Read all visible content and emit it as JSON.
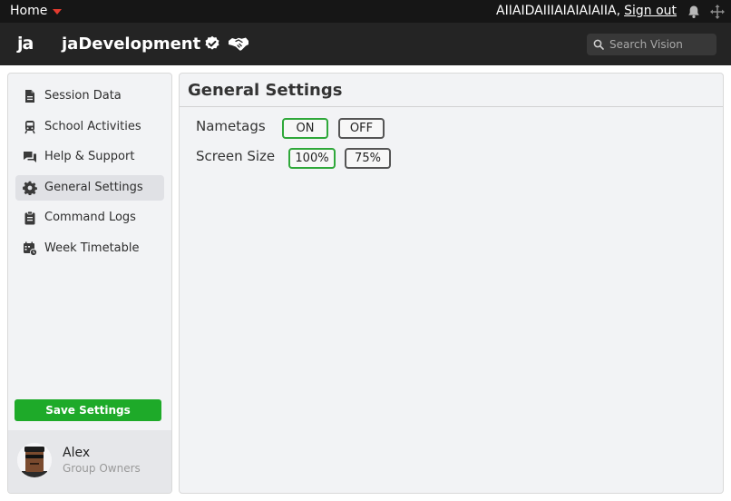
{
  "topbar": {
    "home_label": "Home",
    "username": "AIIAIDAIIIAIAIAIAIIA,",
    "signout_label": "Sign out"
  },
  "header": {
    "logo_text": "ja",
    "brand_name": "jaDevelopment",
    "search_placeholder": "Search Vision"
  },
  "sidebar": {
    "items": [
      {
        "label": "Session Data",
        "icon": "document-icon"
      },
      {
        "label": "School Activities",
        "icon": "train-icon"
      },
      {
        "label": "Help & Support",
        "icon": "chat-icon"
      },
      {
        "label": "General Settings",
        "icon": "gear-icon",
        "active": true
      },
      {
        "label": "Command Logs",
        "icon": "clipboard-icon"
      },
      {
        "label": "Week Timetable",
        "icon": "calendar-clock-icon"
      }
    ],
    "save_label": "Save Settings",
    "profile": {
      "name": "Alex",
      "role": "Group Owners"
    }
  },
  "main": {
    "title": "General Settings",
    "settings": [
      {
        "label": "Nametags",
        "options": [
          "ON",
          "OFF"
        ],
        "selected": "ON"
      },
      {
        "label": "Screen Size",
        "options": [
          "100%",
          "75%"
        ],
        "selected": "100%"
      }
    ]
  },
  "colors": {
    "accent_green": "#1eaa29",
    "selected_border": "#2fa83a",
    "header_bg": "#242424",
    "topbar_bg": "#161616",
    "home_caret": "#e33b2f"
  }
}
